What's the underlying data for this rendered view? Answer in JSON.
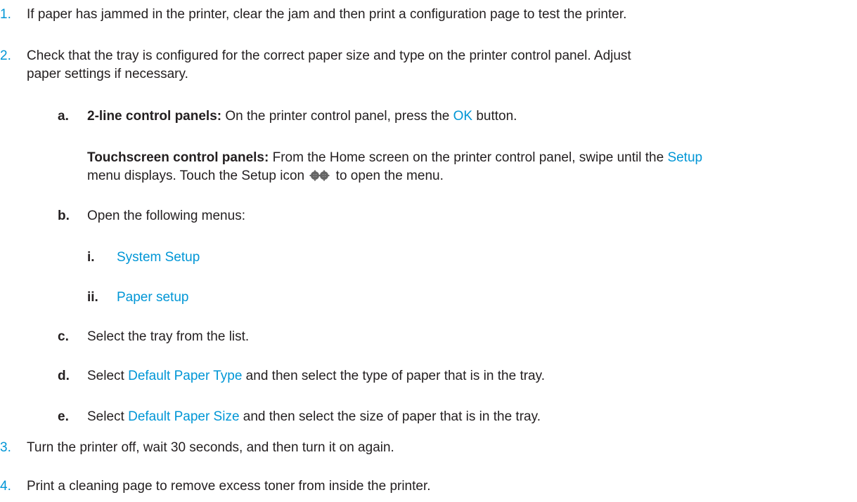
{
  "steps": [
    {
      "num": "1.",
      "text": "If paper has jammed in the printer, clear the jam and then print a configuration page to test the printer."
    },
    {
      "num": "2.",
      "text_line1": "Check that the tray is configured for the correct paper size and type on the printer control panel. Adjust",
      "text_line2": "paper settings if necessary.",
      "substeps": {
        "a": {
          "letter": "a.",
          "label": "2-line control panels:",
          "before_ok": " On the printer control panel, press the ",
          "ok": "OK",
          "after_ok": " button.",
          "touch_label": "Touchscreen control panels:",
          "touch_text1": " From the Home screen on the printer control panel, swipe until the ",
          "touch_setup": "Setup",
          "touch_text2": "menu displays. Touch the Setup icon",
          "touch_text3": " to open the menu.",
          "icon": "gear-icon"
        },
        "b": {
          "letter": "b.",
          "text": "Open the following menus:",
          "items": [
            {
              "num": "i.",
              "text": "System Setup"
            },
            {
              "num": "ii.",
              "text": "Paper setup"
            }
          ]
        },
        "c": {
          "letter": "c.",
          "text": "Select the tray from the list."
        },
        "d": {
          "letter": "d.",
          "before": "Select ",
          "link": "Default Paper Type",
          "after": " and then select the type of paper that is in the tray."
        },
        "e": {
          "letter": "e.",
          "before": "Select ",
          "link": "Default Paper Size",
          "after": " and then select the size of paper that is in the tray."
        }
      }
    },
    {
      "num": "3.",
      "text": "Turn the printer off, wait 30 seconds, and then turn it on again."
    },
    {
      "num": "4.",
      "text": "Print a cleaning page to remove excess toner from inside the printer."
    }
  ],
  "colors": {
    "accent": "#0096d6",
    "text": "#231f20"
  }
}
